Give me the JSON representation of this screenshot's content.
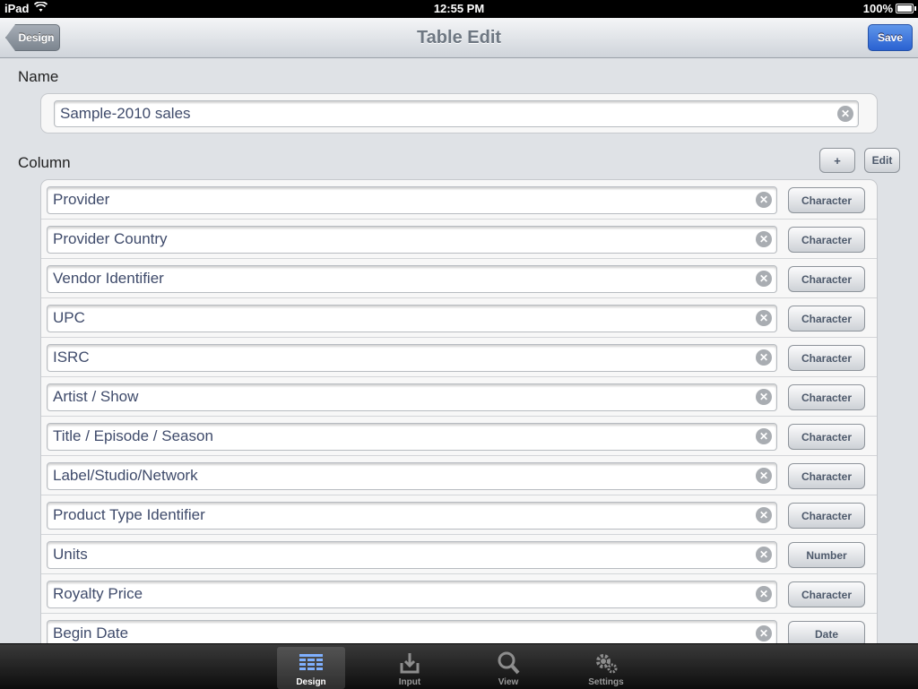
{
  "status_bar": {
    "device": "iPad",
    "time": "12:55 PM",
    "battery": "100%",
    "battery_level": 1.0
  },
  "nav": {
    "back_label": "Design",
    "title": "Table Edit",
    "save_label": "Save"
  },
  "name_section": {
    "label": "Name",
    "value": "Sample-2010 sales"
  },
  "column_section": {
    "label": "Column",
    "add_label": "+",
    "edit_label": "Edit",
    "columns": [
      {
        "name": "Provider",
        "type": "Character"
      },
      {
        "name": "Provider Country",
        "type": "Character"
      },
      {
        "name": "Vendor Identifier",
        "type": "Character"
      },
      {
        "name": "UPC",
        "type": "Character"
      },
      {
        "name": "ISRC",
        "type": "Character"
      },
      {
        "name": "Artist / Show",
        "type": "Character"
      },
      {
        "name": "Title / Episode / Season",
        "type": "Character"
      },
      {
        "name": "Label/Studio/Network",
        "type": "Character"
      },
      {
        "name": "Product Type Identifier",
        "type": "Character"
      },
      {
        "name": "Units",
        "type": "Number"
      },
      {
        "name": "Royalty Price",
        "type": "Character"
      },
      {
        "name": "Begin Date",
        "type": "Date"
      }
    ]
  },
  "tab_bar": {
    "active": "Design",
    "tabs": [
      {
        "label": "Design",
        "icon": "grid-icon"
      },
      {
        "label": "Input",
        "icon": "input-tray-icon"
      },
      {
        "label": "View",
        "icon": "magnifier-icon"
      },
      {
        "label": "Settings",
        "icon": "gears-icon"
      }
    ]
  },
  "colors": {
    "accent": "#2a61d1",
    "nav_title": "#6e7782",
    "field_text": "#3f4b6b"
  }
}
